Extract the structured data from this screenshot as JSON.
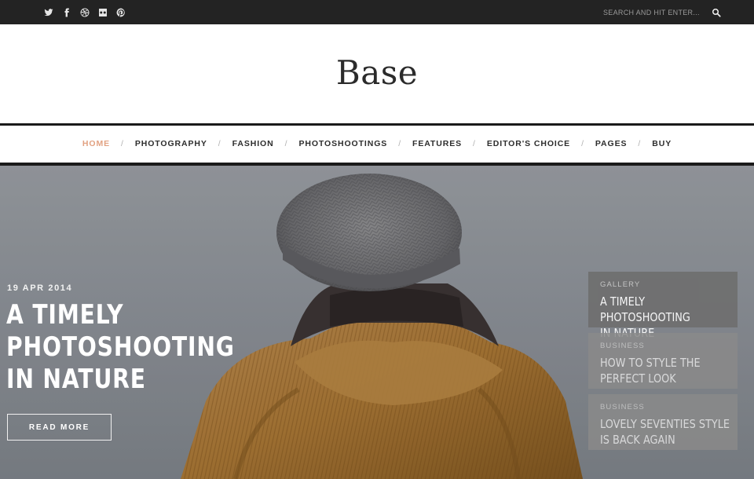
{
  "topbar": {
    "social_icons": [
      "twitter-icon",
      "facebook-icon",
      "dribbble-icon",
      "flickr-icon",
      "pinterest-icon"
    ],
    "search_placeholder": "SEARCH AND HIT ENTER...",
    "search_icon": "search-icon"
  },
  "site": {
    "logo": "Base"
  },
  "nav": {
    "separator": "/",
    "items": [
      {
        "label": "HOME",
        "active": true
      },
      {
        "label": "PHOTOGRAPHY",
        "active": false
      },
      {
        "label": "FASHION",
        "active": false
      },
      {
        "label": "PHOTOSHOOTINGS",
        "active": false
      },
      {
        "label": "FEATURES",
        "active": false
      },
      {
        "label": "EDITOR'S CHOICE",
        "active": false
      },
      {
        "label": "PAGES",
        "active": false
      },
      {
        "label": "BUY",
        "active": false
      }
    ]
  },
  "hero": {
    "date": "19 APR 2014",
    "title_line1": "A TIMELY PHOTOSHOOTING",
    "title_line2": "IN NATURE",
    "read_more": "READ MORE"
  },
  "side_posts": [
    {
      "category": "GALLERY",
      "title_line1": "A TIMELY PHOTOSHOOTING",
      "title_line2": "IN NATURE",
      "active": true
    },
    {
      "category": "BUSINESS",
      "title_line1": "HOW TO STYLE THE",
      "title_line2": "PERFECT LOOK",
      "active": false
    },
    {
      "category": "BUSINESS",
      "title_line1": "LOVELY SEVENTIES STYLE",
      "title_line2": "IS BACK AGAIN",
      "active": false
    }
  ],
  "colors": {
    "topbar": "#232323",
    "nav_active": "#e2a282",
    "nav_text": "#2d2d2d",
    "card_active": "#6f6f6f",
    "card_inactive": "#8a8a8a"
  }
}
